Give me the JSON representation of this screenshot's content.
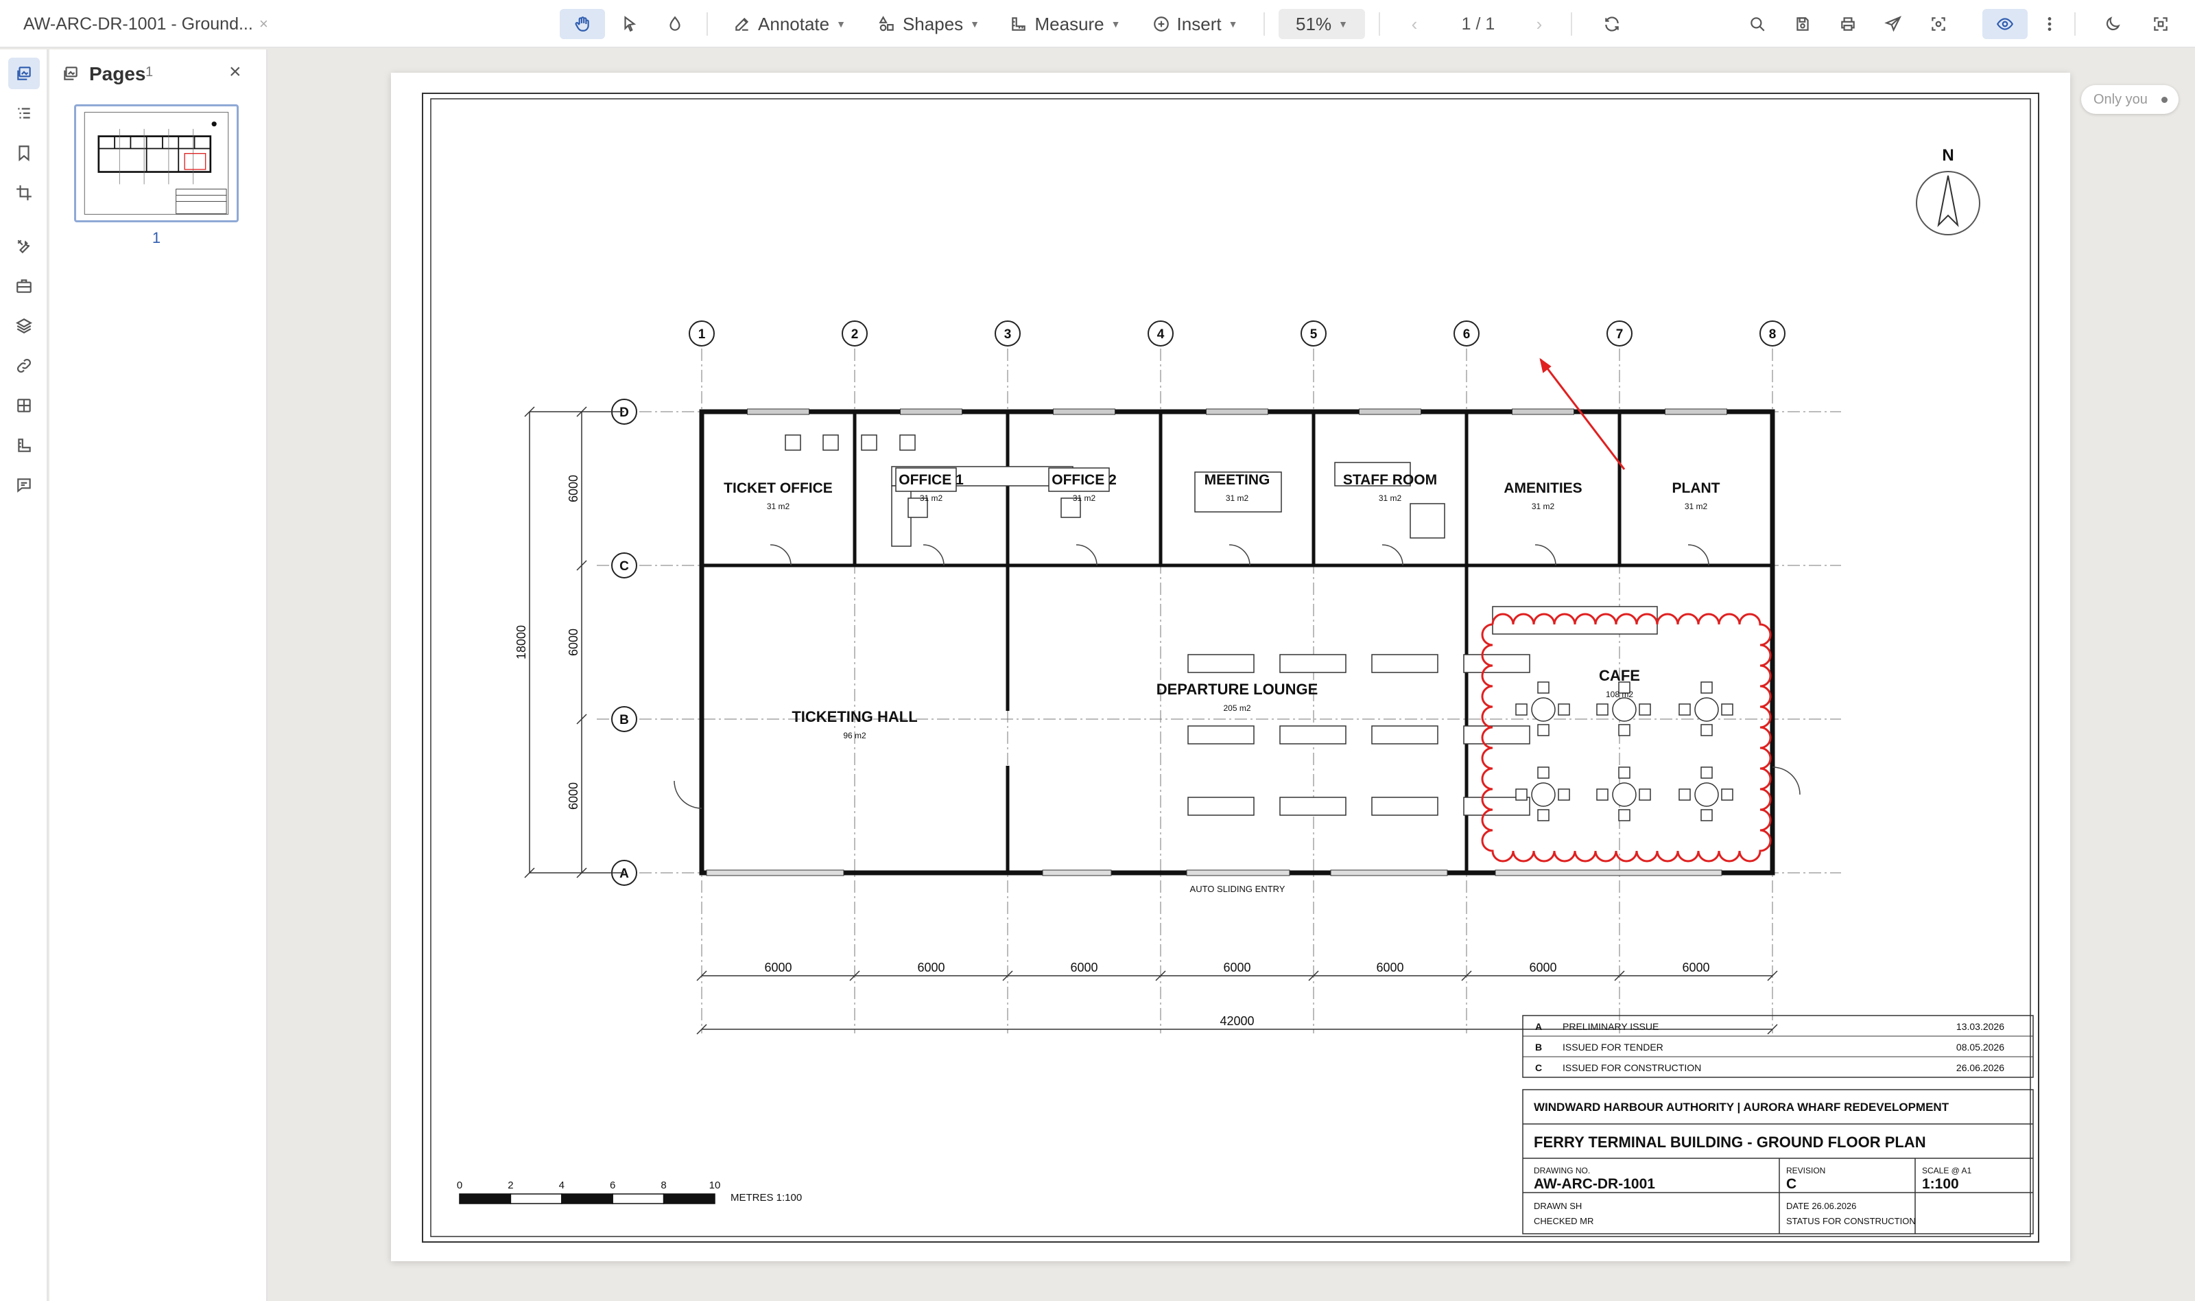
{
  "window": {
    "title": "AW-ARC-DR-1001 - Ground...",
    "close_glyph": "×"
  },
  "toolbar": {
    "annotate_label": "Annotate",
    "shapes_label": "Shapes",
    "measure_label": "Measure",
    "insert_label": "Insert",
    "zoom": "51%",
    "page_indicator": "1 / 1"
  },
  "sidebar": {
    "title": "Pages",
    "count": "1",
    "thumbnail_label": "1"
  },
  "status": {
    "only_you": "Only you"
  },
  "drawing": {
    "north": "N",
    "gridlines_numbered": [
      "1",
      "2",
      "3",
      "4",
      "5",
      "6",
      "7",
      "8"
    ],
    "gridlines_lettered": [
      "D",
      "C",
      "B",
      "A"
    ],
    "rooms": [
      {
        "name": "TICKET OFFICE",
        "area": "31 m2"
      },
      {
        "name": "OFFICE 1",
        "area": "31 m2"
      },
      {
        "name": "OFFICE 2",
        "area": "31 m2"
      },
      {
        "name": "MEETING",
        "area": "31 m2"
      },
      {
        "name": "STAFF ROOM",
        "area": "31 m2"
      },
      {
        "name": "AMENITIES",
        "area": "31 m2"
      },
      {
        "name": "PLANT",
        "area": "31 m2"
      },
      {
        "name": "TICKETING HALL",
        "area": "96 m2"
      },
      {
        "name": "DEPARTURE LOUNGE",
        "area": "205 m2"
      },
      {
        "name": "CAFE",
        "area": "108 m2"
      }
    ],
    "entry_label": "AUTO SLIDING ENTRY",
    "bay_dimensions": [
      "6000",
      "6000",
      "6000",
      "6000",
      "6000",
      "6000",
      "6000"
    ],
    "overall_width": "42000",
    "row_dimensions": [
      "6000",
      "6000",
      "6000"
    ],
    "overall_depth": "18000",
    "scale_bar": {
      "ticks": [
        "0",
        "2",
        "4",
        "6",
        "8",
        "10"
      ],
      "label": "METRES  1:100"
    },
    "revisions": [
      {
        "rev": "A",
        "description": "PRELIMINARY ISSUE",
        "date": "13.03.2026"
      },
      {
        "rev": "B",
        "description": "ISSUED FOR TENDER",
        "date": "08.05.2026"
      },
      {
        "rev": "C",
        "description": "ISSUED FOR CONSTRUCTION",
        "date": "26.06.2026"
      }
    ],
    "title_block": {
      "client": "WINDWARD HARBOUR AUTHORITY | AURORA WHARF REDEVELOPMENT",
      "title": "FERRY TERMINAL BUILDING - GROUND FLOOR PLAN",
      "drawing_no_label": "DRAWING NO.",
      "drawing_no": "AW-ARC-DR-1001",
      "revision_label": "REVISION",
      "revision": "C",
      "scale_label": "SCALE @ A1",
      "scale": "1:100",
      "drawn": "DRAWN  SH",
      "checked": "CHECKED  MR",
      "date": "DATE  26.06.2026",
      "status": "STATUS  FOR CONSTRUCTION"
    }
  },
  "colors": {
    "accent": "#2f5db0",
    "markup_red": "#e02020"
  }
}
